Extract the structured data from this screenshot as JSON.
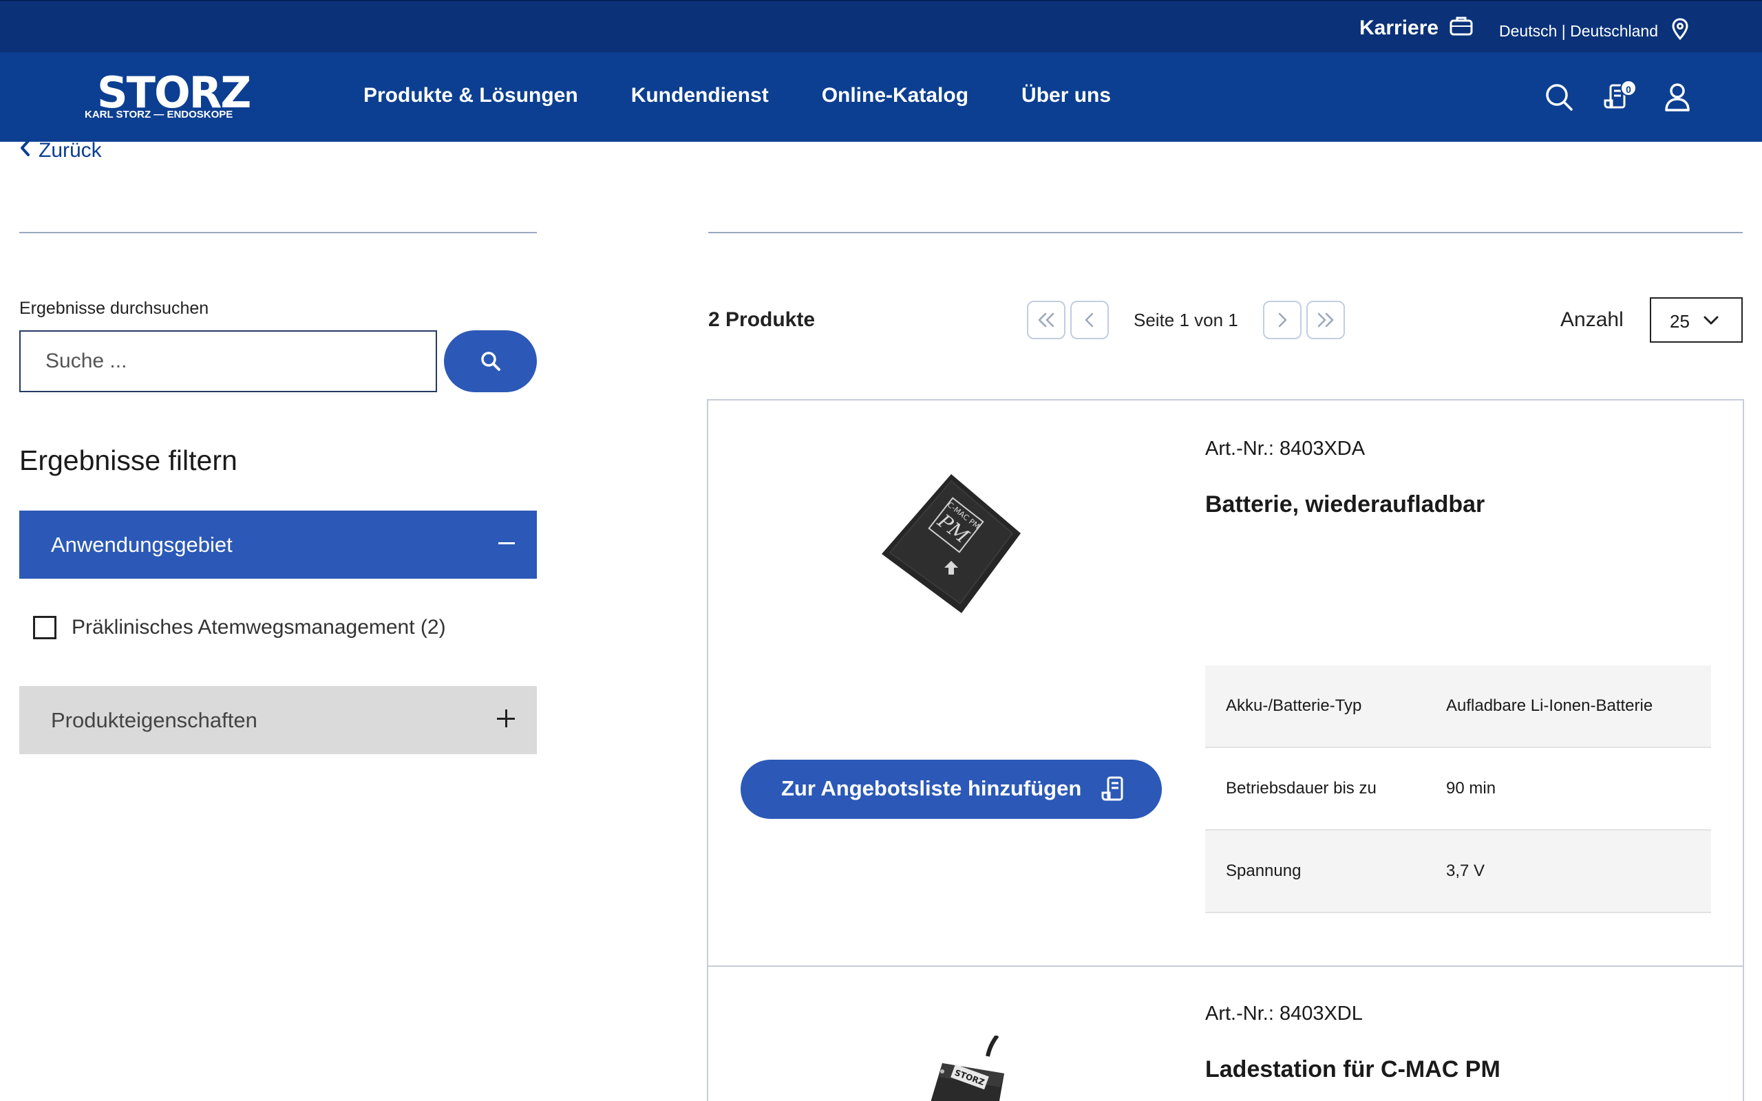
{
  "topbar": {
    "career": "Karriere",
    "language": "Deutsch | Deutschland"
  },
  "header": {
    "logo_text": "STORZ",
    "logo_sub": "KARL STORZ — ENDOSKOPE",
    "nav": [
      "Produkte & Lösungen",
      "Kundendienst",
      "Online-Katalog",
      "Über uns"
    ],
    "cart_count": "0"
  },
  "back_label": "Zurück",
  "sidebar": {
    "search_label": "Ergebnisse durchsuchen",
    "search_placeholder": "Suche ...",
    "filter_title": "Ergebnisse filtern",
    "accordion_application": "Anwendungsgebiet",
    "filter_option": "Präklinisches Atemwegsmanagement (2)",
    "accordion_properties": "Produkteigenschaften"
  },
  "results": {
    "count": "2 Produkte",
    "page_info": "Seite 1 von 1",
    "per_page_label": "Anzahl",
    "per_page_value": "25"
  },
  "products": [
    {
      "art_nr": "Art.-Nr.: 8403XDA",
      "name": "Batterie, wiederaufladbar",
      "image_label": "C-MAC PM",
      "add_label": "Zur Angebotsliste hinzufügen",
      "specs": [
        {
          "key": "Akku-/Batterie-Typ",
          "value": "Aufladbare Li-Ionen-Batterie"
        },
        {
          "key": "Betriebsdauer bis zu",
          "value": "90 min"
        },
        {
          "key": "Spannung",
          "value": "3,7 V"
        }
      ]
    },
    {
      "art_nr": "Art.-Nr.: 8403XDL",
      "name": "Ladestation für C-MAC PM",
      "image_label": "STORZ"
    }
  ],
  "colors": {
    "topbar": "#0b3278",
    "nav": "#0c3f91",
    "accent": "#2c59b7"
  }
}
